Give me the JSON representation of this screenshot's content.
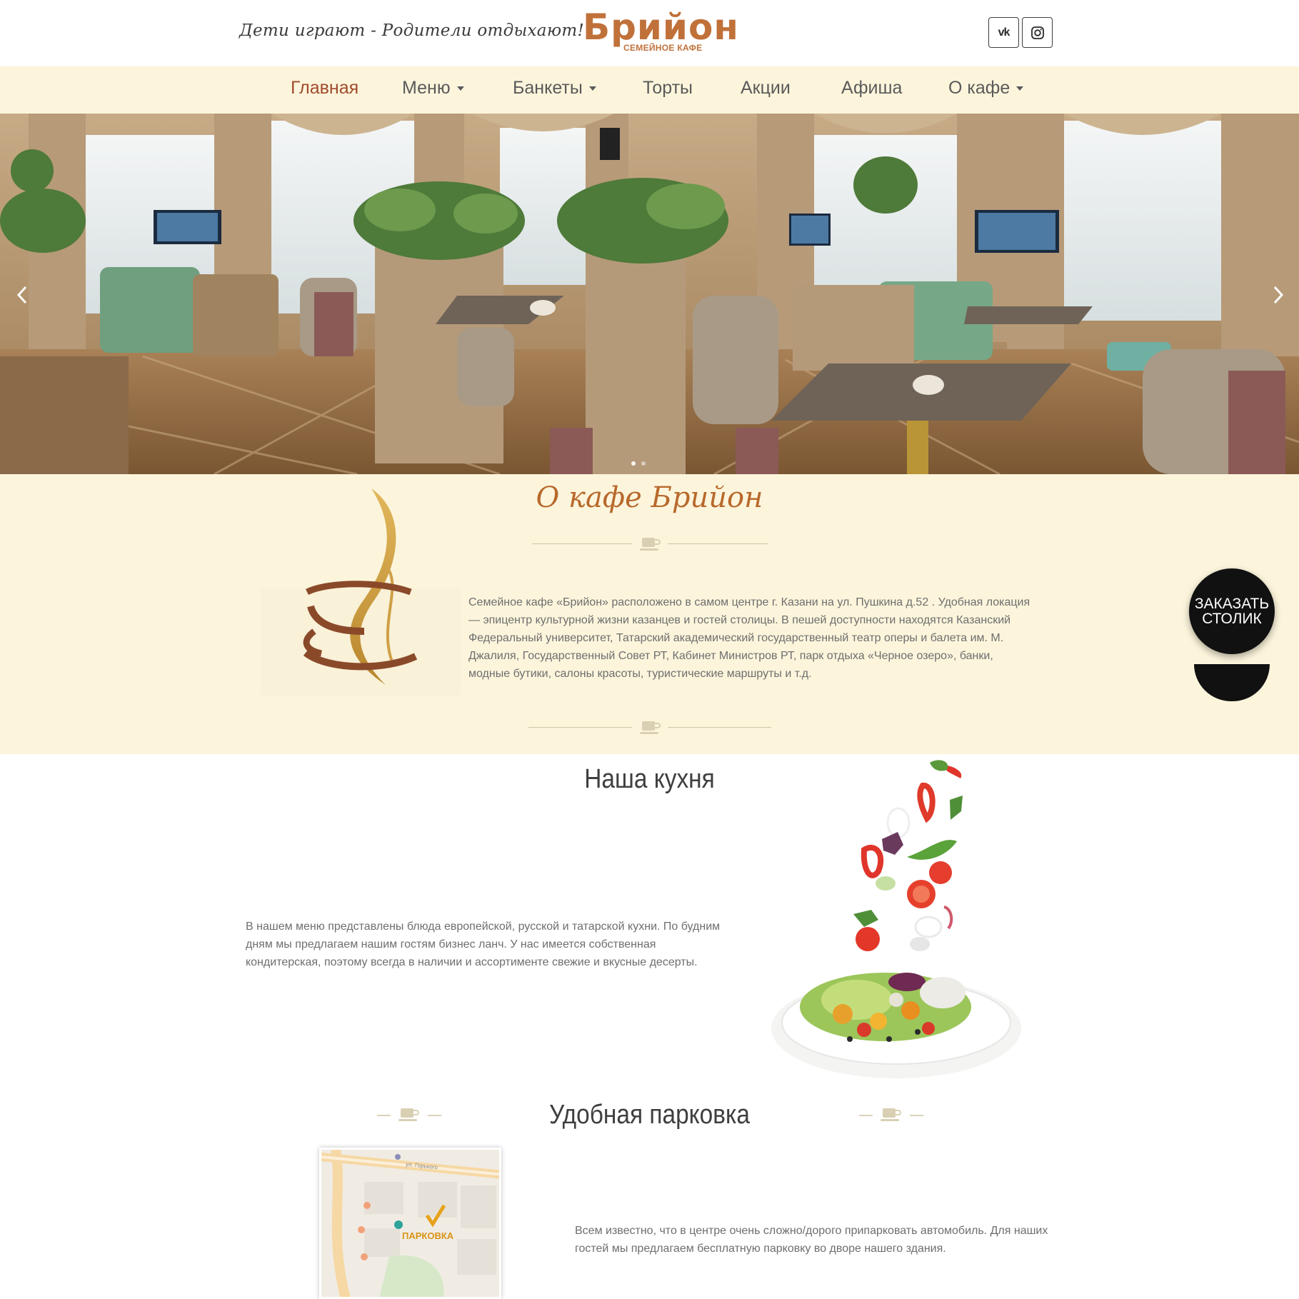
{
  "header": {
    "tagline": "Дети играют - Родители отдыхают!",
    "logo_main": "Брийон",
    "logo_sub": "СЕМЕЙНОЕ КАФЕ",
    "social": [
      {
        "name": "vk-icon",
        "glyph": "vk"
      },
      {
        "name": "instagram-icon"
      }
    ]
  },
  "nav": {
    "items": [
      {
        "label": "Главная",
        "active": true,
        "dropdown": false
      },
      {
        "label": "Меню",
        "active": false,
        "dropdown": true
      },
      {
        "label": "Банкеты",
        "active": false,
        "dropdown": true
      },
      {
        "label": "Торты",
        "active": false,
        "dropdown": false
      },
      {
        "label": "Акции",
        "active": false,
        "dropdown": false
      },
      {
        "label": "Афиша",
        "active": false,
        "dropdown": false
      },
      {
        "label": "О кафе",
        "active": false,
        "dropdown": true
      }
    ]
  },
  "hero": {
    "prev_icon": "chevron-left-icon",
    "next_icon": "chevron-right-icon",
    "slides_count": 2,
    "active_slide": 1
  },
  "about": {
    "title": "О кафе Брийон",
    "text": "Семейное кафе «Брийон» расположено в самом центре г. Казани на ул. Пушкина д.52 . Удобная локация — эпицентр культурной жизни казанцев и гостей столицы. В пешей доступности находятся Казанский Федеральный университет, Татарский академический государственный театр оперы и балета им. М. Джалиля, Государственный Совет РТ, Кабинет Министров РТ, парк отдыха «Черное озеро», банки, модные бутики, салоны красоты, туристические маршруты и т.д."
  },
  "order_button": {
    "line1": "ЗАКАЗАТЬ",
    "line2": "СТОЛИК"
  },
  "kitchen": {
    "title": "Наша кухня",
    "text": "В нашем меню представлены блюда европейской, русской и татарской кухни. По будним дням мы предлагаем нашим гостям бизнес ланч. У нас имеется собственная кондитерская, поэтому всегда в наличии и ассортименте свежие и вкусные десерты."
  },
  "parking": {
    "title": "Удобная парковка",
    "text": "Всем известно, что в центре очень сложно/дорого припарковать автомобиль. Для наших гостей мы предлагаем бесплатную парковку во дворе нашего здания.",
    "map_label": "ПАРКОВКА",
    "map_street": "ул. Горького"
  },
  "colors": {
    "accent": "#a14a2c",
    "brand": "#c0713a",
    "cream": "#fcf5dc",
    "title_gold": "#b8692c"
  }
}
